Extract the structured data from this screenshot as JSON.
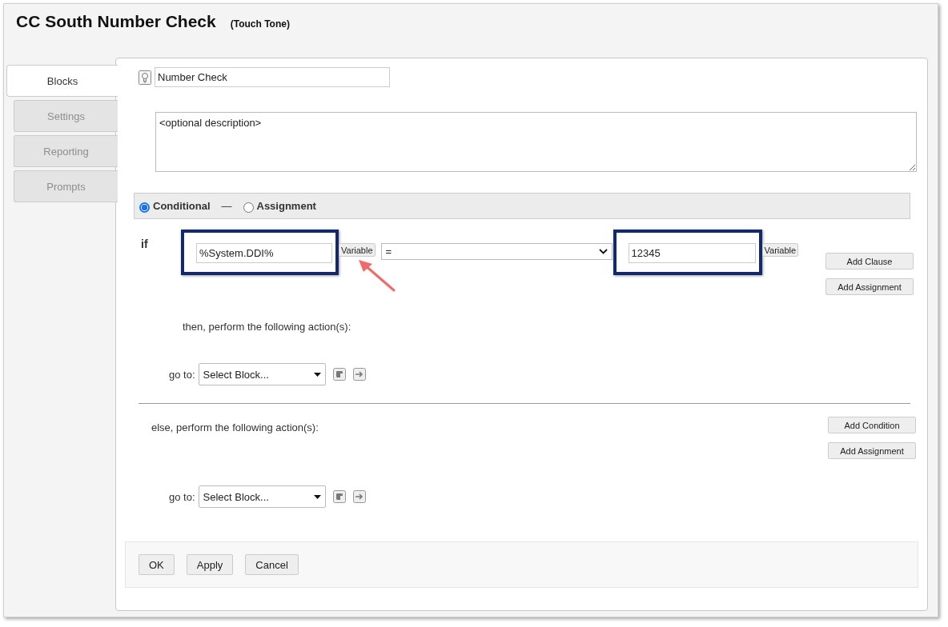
{
  "window": {
    "title": "CC South Number Check",
    "subtitle": "(Touch Tone)"
  },
  "tabs": [
    {
      "label": "Blocks",
      "selected": true
    },
    {
      "label": "Settings",
      "selected": false
    },
    {
      "label": "Reporting",
      "selected": false
    },
    {
      "label": "Prompts",
      "selected": false
    }
  ],
  "block": {
    "name": "Number Check",
    "description": "<optional description>"
  },
  "mode_options": [
    {
      "label": "Conditional",
      "selected": true
    },
    {
      "label": "Assignment",
      "selected": false
    }
  ],
  "mode_separator": "—",
  "condition": {
    "keyword": "if",
    "left": {
      "value": "%System.DDI%",
      "highlighted": true,
      "button": "Variable",
      "arrow": true
    },
    "operator": "=",
    "right": {
      "value": "12345",
      "highlighted": true,
      "button": "Variable",
      "arrow": false
    },
    "buttons": [
      "Add Clause",
      "Add Assignment"
    ]
  },
  "then": {
    "label": "then, perform the following action(s):",
    "goto_label": "go to:",
    "goto_value": "Select Block..."
  },
  "else": {
    "label": "else, perform the following action(s):",
    "buttons": [
      "Add Condition",
      "Add Assignment"
    ],
    "goto_label": "go to:",
    "goto_value": "Select Block..."
  },
  "footer_buttons": [
    "OK",
    "Apply",
    "Cancel"
  ]
}
